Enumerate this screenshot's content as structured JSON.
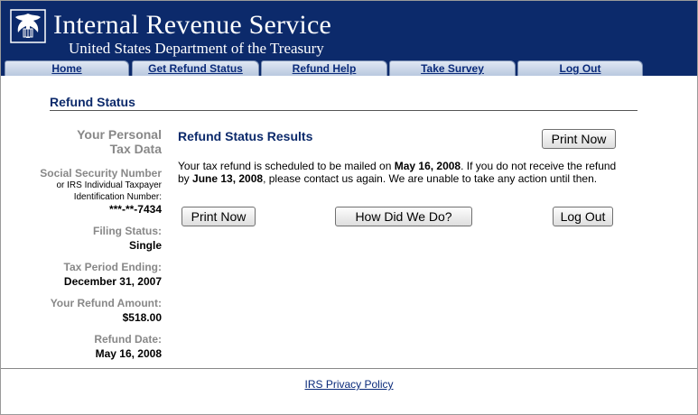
{
  "header": {
    "title": "Internal Revenue Service",
    "subtitle": "United States Department of the Treasury"
  },
  "nav": [
    {
      "label": "Home"
    },
    {
      "label": "Get Refund Status"
    },
    {
      "label": "Refund Help"
    },
    {
      "label": "Take Survey"
    },
    {
      "label": "Log Out"
    }
  ],
  "section_title": "Refund Status",
  "taxdata": {
    "heading_line1": "Your Personal",
    "heading_line2": "Tax Data",
    "ssn_label": "Social Security Number",
    "ssn_sub1": "or IRS Individual Taxpayer",
    "ssn_sub2": "Identification Number:",
    "ssn_value": "***-**-7434",
    "filing_label": "Filing Status:",
    "filing_value": "Single",
    "period_label": "Tax Period Ending:",
    "period_value": "December 31, 2007",
    "amount_label": "Your Refund Amount:",
    "amount_value": "$518.00",
    "date_label": "Refund Date:",
    "date_value": "May 16, 2008"
  },
  "results": {
    "title": "Refund Status Results",
    "msg_part1": "Your tax refund is scheduled to be mailed on ",
    "msg_date1": "May 16, 2008",
    "msg_part2": ". If you do not receive the refund by ",
    "msg_date2": "June 13, 2008",
    "msg_part3": ", please contact us again. We are unable to take any action until then."
  },
  "buttons": {
    "print_top": "Print Now",
    "print_bottom": "Print Now",
    "survey": "How Did We Do?",
    "logout": "Log Out"
  },
  "footer": {
    "privacy": "IRS Privacy Policy"
  },
  "colors": {
    "header_bg": "#0c2a6b",
    "link": "#0a2a7a"
  }
}
